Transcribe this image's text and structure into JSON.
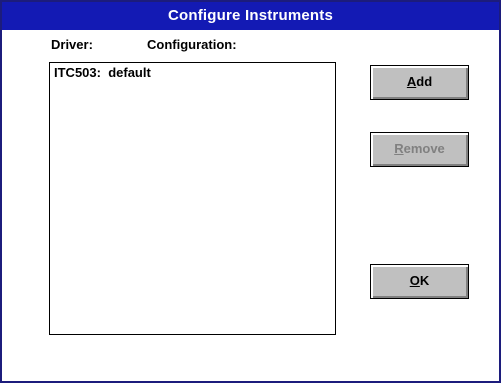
{
  "window": {
    "title": "Configure Instruments"
  },
  "columns": {
    "driver": "Driver:",
    "configuration": "Configuration:"
  },
  "list": {
    "items": [
      {
        "driver": "ITC503:",
        "configuration": "default"
      }
    ]
  },
  "buttons": {
    "add": {
      "mnemonic": "A",
      "rest": "dd"
    },
    "remove": {
      "mnemonic": "R",
      "rest": "emove",
      "enabled": false
    },
    "ok": {
      "mnemonic": "O",
      "rest": "K"
    }
  },
  "colors": {
    "title_bar": "#131ab4",
    "button_face": "#c0c0c0",
    "disabled_text": "#808080"
  }
}
